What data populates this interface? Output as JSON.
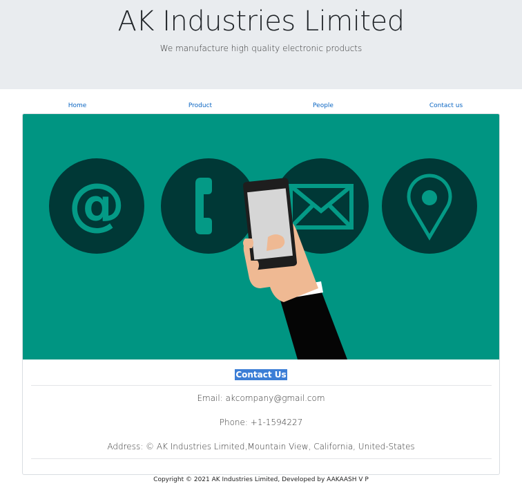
{
  "header": {
    "title": "AK Industries Limited",
    "subtitle": "We manufacture high quality electronic products"
  },
  "nav": {
    "items": [
      {
        "label": "Home"
      },
      {
        "label": "Product"
      },
      {
        "label": "People"
      },
      {
        "label": "Contact us"
      }
    ]
  },
  "banner": {
    "icons": [
      "at-sign-icon",
      "phone-icon",
      "envelope-icon",
      "location-pin-icon",
      "hand-holding-smartphone-illustration"
    ],
    "colors": {
      "background": "#009582",
      "circle": "#003836",
      "glyph": "#049a86"
    }
  },
  "contact": {
    "heading": "Contact Us",
    "email": "Email: akcompany@gmail.com",
    "phone": "Phone: +1-1594227",
    "address": "Address: © AK Industries Limited,Mountain View, California, United-States"
  },
  "footer": {
    "text": "Copyright © 2021 AK Industries Limited, Developed by AAKAASH V P"
  }
}
